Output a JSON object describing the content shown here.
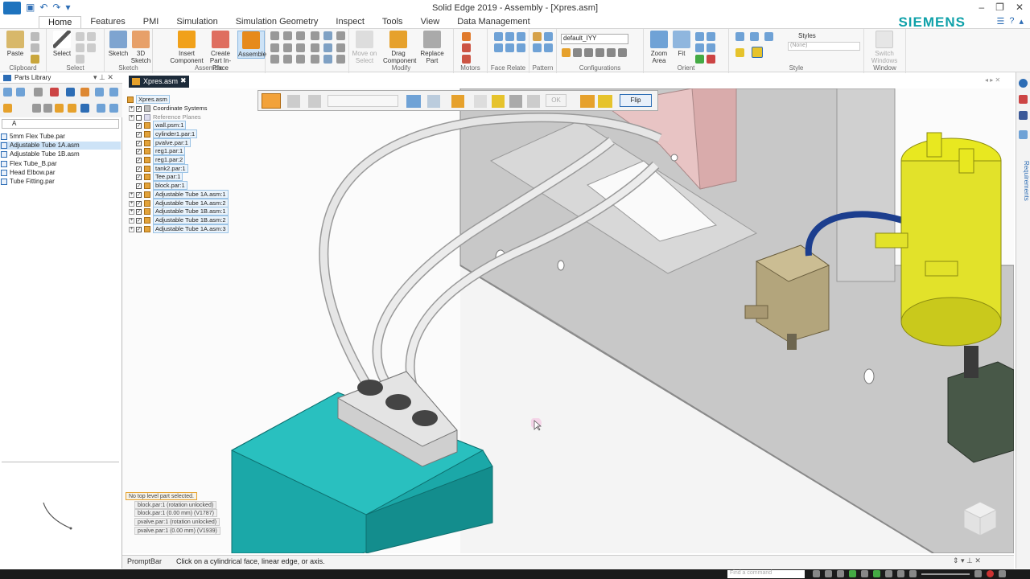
{
  "window": {
    "title": "Solid Edge 2019 - Assembly - [Xpres.asm]",
    "brand": "SIEMENS"
  },
  "ribbon_tabs": [
    "Home",
    "Features",
    "PMI",
    "Simulation",
    "Simulation Geometry",
    "Inspect",
    "Tools",
    "View",
    "Data Management"
  ],
  "ribbon": {
    "clipboard": {
      "paste": "Paste",
      "group": "Clipboard"
    },
    "select": {
      "select": "Select",
      "group": "Select"
    },
    "sketch": {
      "sketch": "Sketch",
      "sketch3d": "3D Sketch",
      "group": "Sketch"
    },
    "assemble": {
      "insert": "Insert Component",
      "create_in_place": "Create Part In-Place",
      "assemble": "Assemble",
      "group": "Assemble"
    },
    "modify": {
      "move_on_select": "Move on Select",
      "drag": "Drag Component",
      "replace": "Replace Part",
      "group": "Modify"
    },
    "motors_group": "Motors",
    "face_relate_group": "Face Relate",
    "pattern_group": "Pattern",
    "configurations": {
      "value": "default_IYY",
      "group": "Configurations"
    },
    "orient": {
      "zoom_area": "Zoom Area",
      "fit": "Fit",
      "group": "Orient"
    },
    "style": {
      "label": "Styles",
      "value": "(None)",
      "group": "Style"
    },
    "window": {
      "switch": "Switch Windows",
      "group": "Window"
    }
  },
  "parts_library": {
    "title": "Parts Library",
    "path": "A",
    "items": [
      "5mm Flex Tube.par",
      "Adjustable Tube 1A.asm",
      "Adjustable Tube 1B.asm",
      "Flex Tube_B.par",
      "Head Elbow.par",
      "Tube Fitting.par"
    ],
    "selected_index": 1
  },
  "document_tab": "Xpres.asm",
  "tree": [
    {
      "label": "Xpres.asm",
      "level": 0,
      "kind": "asm"
    },
    {
      "label": "Coordinate Systems",
      "level": 1,
      "kind": "folder"
    },
    {
      "label": "Reference Planes",
      "level": 1,
      "kind": "folder"
    },
    {
      "label": "wall.psm:1",
      "level": 1,
      "kind": "part"
    },
    {
      "label": "cylinder1.par:1",
      "level": 1,
      "kind": "part"
    },
    {
      "label": "pvalve.par:1",
      "level": 1,
      "kind": "part"
    },
    {
      "label": "reg1.par:1",
      "level": 1,
      "kind": "part"
    },
    {
      "label": "reg1.par:2",
      "level": 1,
      "kind": "part"
    },
    {
      "label": "tank2.par:1",
      "level": 1,
      "kind": "part"
    },
    {
      "label": "Tee.par:1",
      "level": 1,
      "kind": "part"
    },
    {
      "label": "block.par:1",
      "level": 1,
      "kind": "part"
    },
    {
      "label": "Adjustable Tube 1A.asm:1",
      "level": 1,
      "kind": "asm"
    },
    {
      "label": "Adjustable Tube 1A.asm:2",
      "level": 1,
      "kind": "asm"
    },
    {
      "label": "Adjustable Tube 1B.asm:1",
      "level": 1,
      "kind": "asm"
    },
    {
      "label": "Adjustable Tube 1B.asm:2",
      "level": 1,
      "kind": "asm"
    },
    {
      "label": "Adjustable Tube 1A.asm:3",
      "level": 1,
      "kind": "asm"
    }
  ],
  "command_bar": {
    "ok": "OK",
    "flip": "Flip"
  },
  "relations_status": {
    "header": "No top level part selected.",
    "lines": [
      "block.par:1  (rotation unlocked)",
      "block.par:1  (0.00 mm)  (V1787)",
      "pvalve.par:1  (rotation unlocked)",
      "pvalve.par:1  (0.00 mm)  (V1939)"
    ]
  },
  "prompt_bar": {
    "label": "PromptBar",
    "text": "Click on a cylindrical face, linear edge, or axis."
  },
  "right_panel": {
    "requirements": "Requirements"
  },
  "taskbar": {
    "find_placeholder": "Find a command"
  },
  "colors": {
    "accent": "#2d6db5",
    "brand": "#0fa1a9",
    "tank": "#1ba8a8",
    "cylinder": "#e2e22a"
  }
}
